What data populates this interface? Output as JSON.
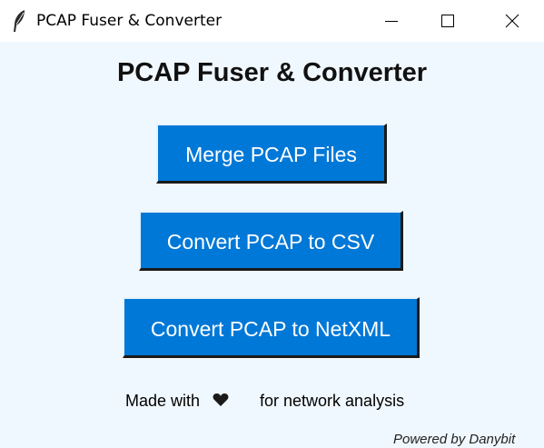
{
  "window": {
    "title": "PCAP Fuser & Converter",
    "icon": "feather-icon",
    "controls": {
      "minimize": "minimize-icon",
      "maximize": "maximize-icon",
      "close": "close-icon"
    }
  },
  "app": {
    "heading": "PCAP Fuser & Converter",
    "buttons": [
      {
        "label": "Merge PCAP Files"
      },
      {
        "label": "Convert PCAP to CSV"
      },
      {
        "label": "Convert PCAP to NetXML"
      }
    ],
    "footer": {
      "made_with": "Made with",
      "heart_icon": "heart-icon",
      "purpose": "for network analysis",
      "powered_by": "Powered by Danybit"
    }
  },
  "colors": {
    "background": "#f0f8ff",
    "button": "#0078d7",
    "button_text": "#ffffff"
  }
}
